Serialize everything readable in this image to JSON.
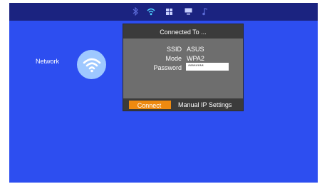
{
  "topbar": {
    "icons": [
      "bluetooth-icon",
      "wifi-icon",
      "apps-icon",
      "monitor-icon",
      "music-icon"
    ]
  },
  "side": {
    "network_label": "Network"
  },
  "dialog": {
    "title": "Connected To ...",
    "fields": [
      {
        "label": "SSID",
        "value": "ASUS"
      },
      {
        "label": "Mode",
        "value": "WPA2"
      },
      {
        "label": "Password",
        "value": "********"
      }
    ],
    "connect_label": "Connect",
    "manual_label": "Manual IP Settings"
  },
  "colors": {
    "background": "#2d4ef0",
    "topbar": "#1b2380",
    "dialog_body": "#6e6e6e",
    "dialog_bar": "#3b3b3b",
    "accent": "#ee8a10",
    "wifi_circle": "#9ec8ff"
  }
}
